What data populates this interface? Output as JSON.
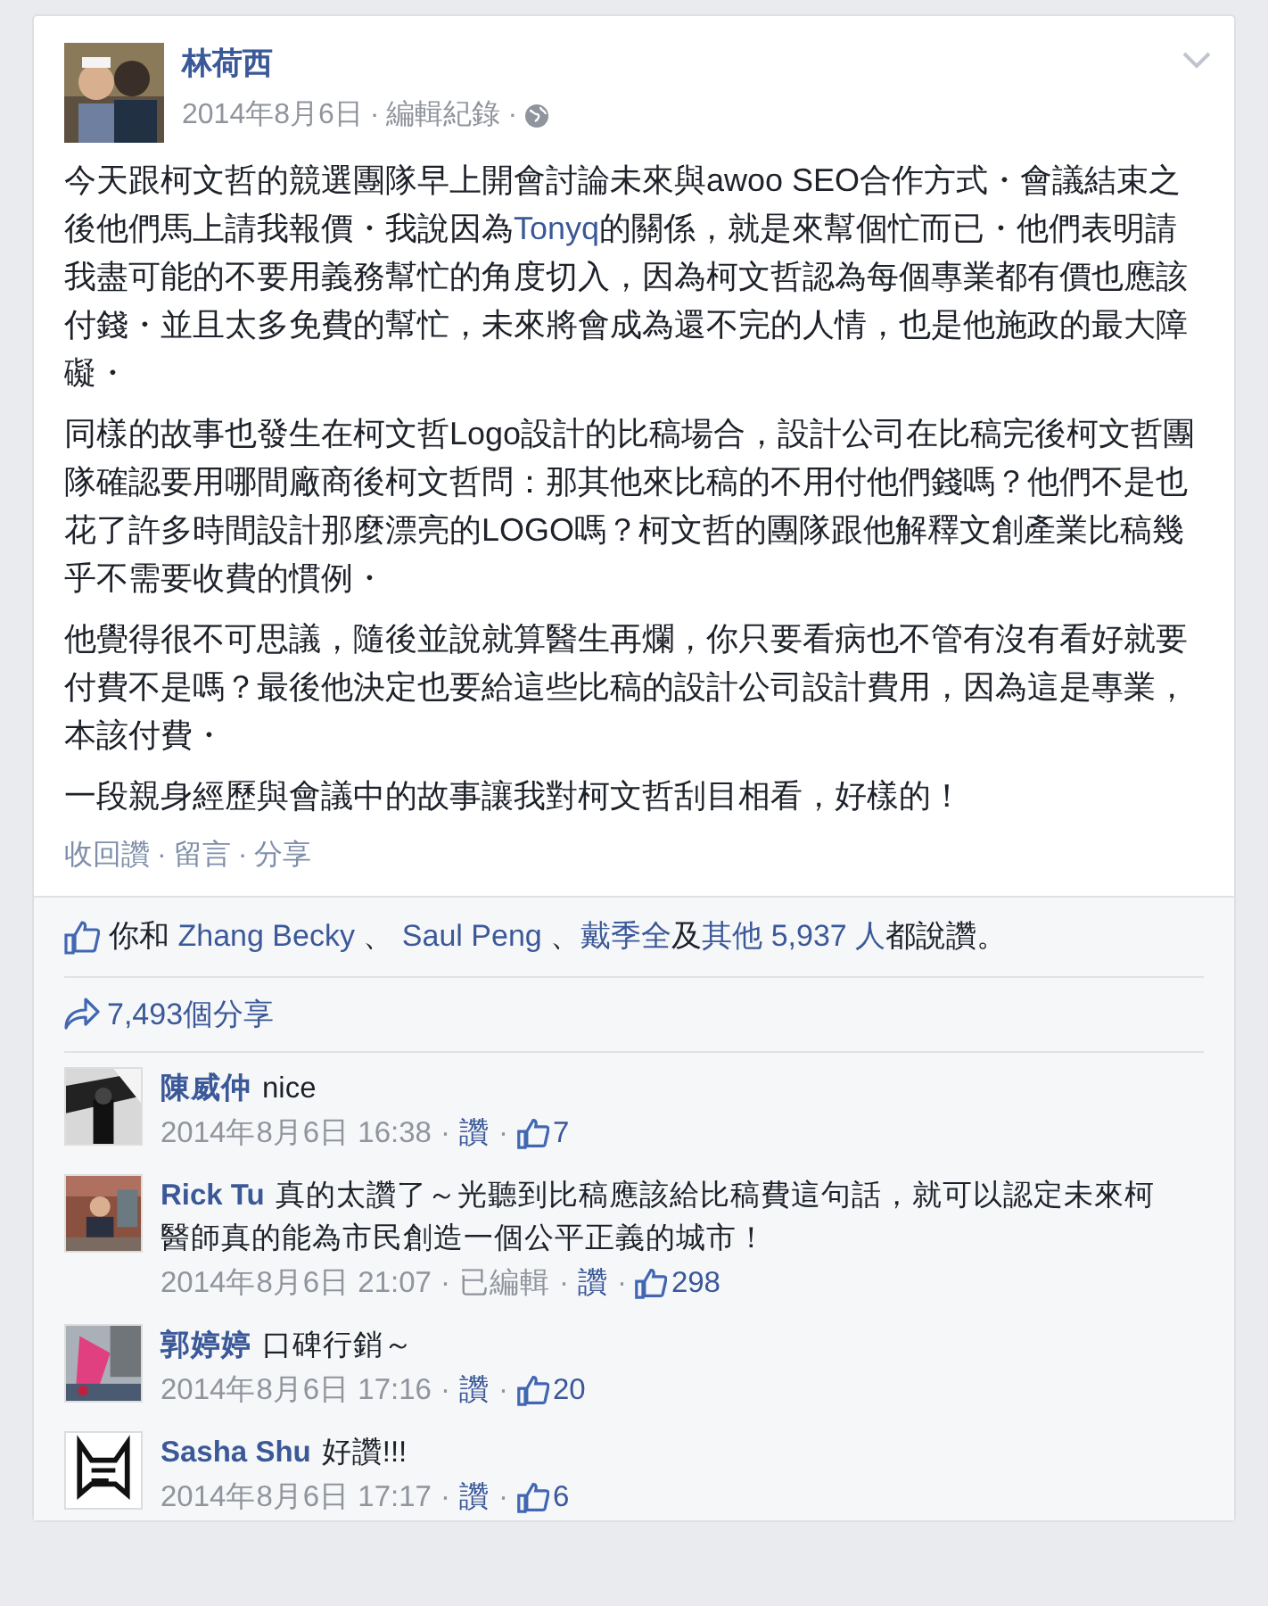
{
  "post": {
    "author": "林荷西",
    "date": "2014年8月6日",
    "edit_history": "編輯紀錄",
    "meta_separators": [
      "·",
      "·"
    ],
    "action_separators": [
      "·",
      "·"
    ],
    "paragraphs": [
      [
        {
          "kind": "text",
          "text": "今天跟柯文哲的競選團隊早上開會討論未來與awoo SEO合作方式・會議結束之後他們馬上請我報價・我說因為"
        },
        {
          "kind": "link",
          "text": "Tonyq"
        },
        {
          "kind": "text",
          "text": "的關係，就是來幫個忙而已・他們表明請我盡可能的不要用義務幫忙的角度切入，因為柯文哲認為每個專業都有價也應該付錢・並且太多免費的幫忙，未來將會成為還不完的人情，也是他施政的最大障礙・"
        }
      ],
      [
        {
          "kind": "text",
          "text": "同樣的故事也發生在柯文哲Logo設計的比稿場合，設計公司在比稿完後柯文哲團隊確認要用哪間廠商後柯文哲問：那其他來比稿的不用付他們錢嗎？他們不是也花了許多時間設計那麼漂亮的LOGO嗎？柯文哲的團隊跟他解釋文創產業比稿幾乎不需要收費的慣例・"
        }
      ],
      [
        {
          "kind": "text",
          "text": "他覺得很不可思議，隨後並說就算醫生再爛，你只要看病也不管有沒有看好就要付費不是嗎？最後他決定也要給這些比稿的設計公司設計費用，因為這是專業，本該付費・"
        }
      ],
      [
        {
          "kind": "text",
          "text": "一段親身經歷與會議中的故事讓我對柯文哲刮目相看，好樣的！"
        }
      ]
    ],
    "actions": [
      "收回讚",
      "留言",
      "分享"
    ]
  },
  "likes": [
    {
      "kind": "text",
      "text": "你和 "
    },
    {
      "kind": "link",
      "text": "Zhang Becky"
    },
    {
      "kind": "text",
      "text": " 、 "
    },
    {
      "kind": "link",
      "text": "Saul Peng"
    },
    {
      "kind": "text",
      "text": " 、"
    },
    {
      "kind": "link",
      "text": "戴季全"
    },
    {
      "kind": "text",
      "text": "及"
    },
    {
      "kind": "link",
      "text": "其他 5,937 人"
    },
    {
      "kind": "text",
      "text": "都說讚。"
    }
  ],
  "shares": "7,493個分享",
  "comments": [
    {
      "name": "陳威仲",
      "text": "nice",
      "time": "2014年8月6日 16:38",
      "like": "讚",
      "likes": "7",
      "separators": [
        "·",
        "·"
      ]
    },
    {
      "name": "Rick Tu",
      "text": "真的太讚了～光聽到比稿應該給比稿費這句話，就可以認定未來柯醫師真的能為市民創造一個公平正義的城市！",
      "time": "2014年8月6日 21:07",
      "edited": "已編輯",
      "like": "讚",
      "likes": "298",
      "separators": [
        "·",
        "·",
        "·"
      ]
    },
    {
      "name": "郭婷婷",
      "text": "口碑行銷～",
      "time": "2014年8月6日 17:16",
      "like": "讚",
      "likes": "20",
      "separators": [
        "·",
        "·"
      ]
    },
    {
      "name": "Sasha Shu",
      "text": "好讚!!!",
      "time": "2014年8月6日 17:17",
      "like": "讚",
      "likes": "6",
      "separators": [
        "·",
        "·"
      ]
    }
  ]
}
